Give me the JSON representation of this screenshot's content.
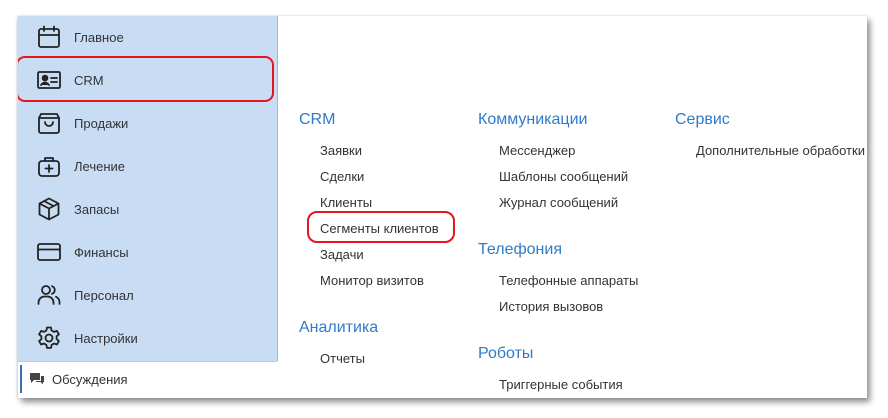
{
  "sidebar": {
    "items": [
      {
        "label": "Главное",
        "icon": "calendar-icon"
      },
      {
        "label": "CRM",
        "icon": "contact-card-icon"
      },
      {
        "label": "Продажи",
        "icon": "shopping-bag-icon"
      },
      {
        "label": "Лечение",
        "icon": "medical-bag-icon"
      },
      {
        "label": "Запасы",
        "icon": "box-icon"
      },
      {
        "label": "Финансы",
        "icon": "credit-card-icon"
      },
      {
        "label": "Персонал",
        "icon": "users-icon"
      },
      {
        "label": "Настройки",
        "icon": "gear-icon"
      }
    ],
    "discussions": {
      "label": "Обсуждения",
      "icon": "chat-icon"
    }
  },
  "groups": {
    "crm": {
      "title": "CRM",
      "links": [
        "Заявки",
        "Сделки",
        "Клиенты",
        "Сегменты клиентов",
        "Задачи",
        "Монитор визитов"
      ]
    },
    "analytics": {
      "title": "Аналитика",
      "links": [
        "Отчеты"
      ]
    },
    "communications": {
      "title": "Коммуникации",
      "links": [
        "Мессенджер",
        "Шаблоны сообщений",
        "Журнал сообщений"
      ]
    },
    "telephony": {
      "title": "Телефония",
      "links": [
        "Телефонные аппараты",
        "История вызовов"
      ]
    },
    "robots": {
      "title": "Роботы",
      "links": [
        "Триггерные события"
      ]
    },
    "service": {
      "title": "Сервис",
      "links": [
        "Дополнительные обработки"
      ]
    }
  },
  "colors": {
    "sidebar_bg": "#c8dcf4",
    "group_title": "#2f7bc8",
    "highlight": "#e8141e"
  }
}
